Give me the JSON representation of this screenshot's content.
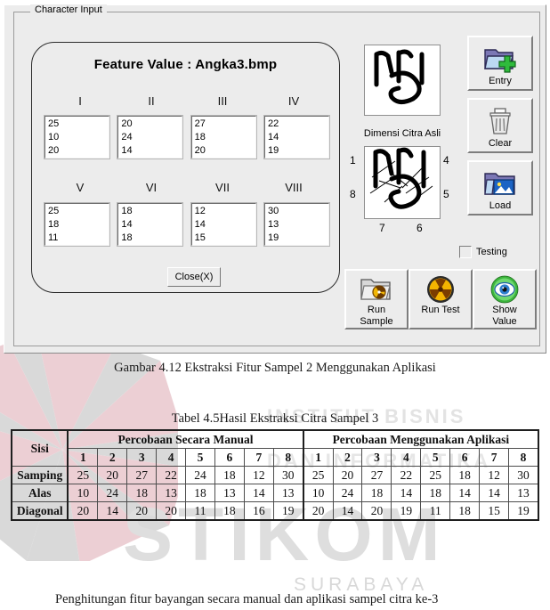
{
  "window": {
    "group_legend": "Character Input"
  },
  "feature_panel": {
    "title": "Feature Value : Angka3.bmp",
    "close_label": "Close(X)",
    "columns_row1": [
      "I",
      "II",
      "III",
      "IV"
    ],
    "columns_row2": [
      "V",
      "VI",
      "VII",
      "VIII"
    ],
    "boxes_row1": [
      [
        "25",
        "10",
        "20"
      ],
      [
        "20",
        "24",
        "14"
      ],
      [
        "27",
        "18",
        "20"
      ],
      [
        "22",
        "14",
        "19"
      ]
    ],
    "boxes_row2": [
      [
        "25",
        "18",
        "11"
      ],
      [
        "18",
        "14",
        "18"
      ],
      [
        "12",
        "14",
        "15"
      ],
      [
        "30",
        "13",
        "19"
      ]
    ]
  },
  "preview": {
    "original_caption": "Dimensi Citra Asli",
    "corner_labels": {
      "left_top": "1",
      "left_bottom": "8",
      "right_top": "4",
      "right_bottom": "5",
      "bottom_left": "7",
      "bottom_right": "6"
    }
  },
  "buttons": {
    "entry": "Entry",
    "clear": "Clear",
    "load": "Load",
    "run_sample_line1": "Run",
    "run_sample_line2": "Sample",
    "run_test": "Run Test",
    "show_value_line1": "Show",
    "show_value_line2": "Value"
  },
  "checkbox": {
    "testing_label": "Testing",
    "testing_checked": false
  },
  "captions": {
    "figure": "Gambar 4.12 Ekstraksi Fitur Sampel 2 Menggunakan Aplikasi",
    "table": "Tabel 4.5Hasil Ekstraksi Citra Sampel 3",
    "paragraph": "Penghitungan fitur bayangan secara manual dan aplikasi sampel citra ke-3"
  },
  "watermark": {
    "stikom": "STIKOM",
    "surabaya": "SURABAYA",
    "institute": "INSTITUT BISNIS",
    "informatika": "DAN INFORMATIKA"
  },
  "colors": {
    "form_background": "#ececec",
    "highlight_red": "#e01b1b",
    "table_border": "#4d4d4d"
  },
  "chart_data": {
    "type": "table",
    "title": "Tabel 4.5Hasil Ekstraksi Citra Sampel 3",
    "row_header_label": "Sisi",
    "group_headers": [
      "Percobaan Secara Manual",
      "Percobaan Menggunakan Aplikasi"
    ],
    "trial_numbers": [
      "1",
      "2",
      "3",
      "4",
      "5",
      "6",
      "7",
      "8"
    ],
    "rows": [
      {
        "label": "Samping",
        "manual": [
          "25",
          "20",
          "27",
          "22",
          "24",
          "18",
          "12",
          "30"
        ],
        "manual_red": [
          false,
          false,
          false,
          false,
          true,
          false,
          false,
          false
        ],
        "aplikasi": [
          "25",
          "20",
          "27",
          "22",
          "25",
          "18",
          "12",
          "30"
        ],
        "aplikasi_red": [
          false,
          false,
          false,
          false,
          true,
          false,
          false,
          false
        ]
      },
      {
        "label": "Alas",
        "manual": [
          "10",
          "24",
          "18",
          "13",
          "18",
          "13",
          "14",
          "13"
        ],
        "manual_red": [
          false,
          false,
          false,
          true,
          false,
          true,
          false,
          false
        ],
        "aplikasi": [
          "10",
          "24",
          "18",
          "14",
          "18",
          "14",
          "14",
          "13"
        ],
        "aplikasi_red": [
          false,
          false,
          false,
          true,
          false,
          true,
          false,
          false
        ]
      },
      {
        "label": "Diagonal",
        "manual": [
          "20",
          "14",
          "20",
          "20",
          "11",
          "18",
          "16",
          "19"
        ],
        "manual_red": [
          false,
          false,
          false,
          true,
          false,
          false,
          true,
          false
        ],
        "aplikasi": [
          "20",
          "14",
          "20",
          "19",
          "11",
          "18",
          "15",
          "19"
        ],
        "aplikasi_red": [
          false,
          false,
          false,
          true,
          false,
          false,
          true,
          false
        ]
      }
    ]
  }
}
